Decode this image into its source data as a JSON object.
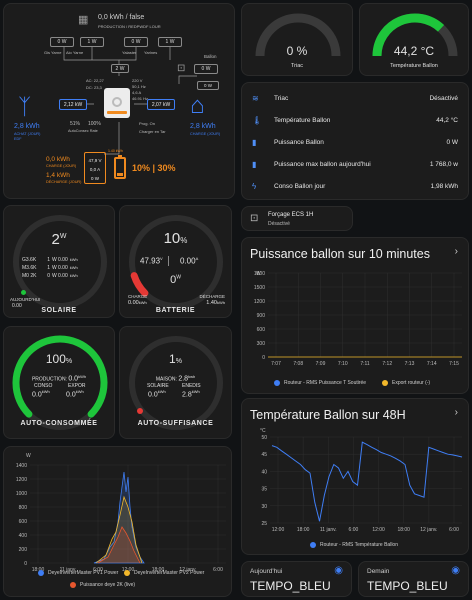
{
  "colors": {
    "blue": "#3f7ef5",
    "green": "#1ec53b",
    "orange": "#f08a1f",
    "red": "#e53935",
    "yellow": "#f2b82b",
    "grey": "#3a3a3a"
  },
  "energy": {
    "top_kwh": "0,0 kWh / false",
    "top_sub": "PRODUCTION / REDPWDF LOUR",
    "pv_boxes": [
      "0 W",
      "1 W",
      "0 W",
      "1 W"
    ],
    "pv_names": [
      "Gis Yarne",
      "Aio Yarne",
      "Yalaster",
      "Yarlnes"
    ],
    "ballon_label": "Ballon",
    "ballon_w": "0 W",
    "ballon_val2": "0 W",
    "mid_stats": [
      "AC: 22,27",
      "DC: 23,3",
      "220 V",
      "50,1 Hz",
      "4,6 A",
      "46.91 Hz"
    ],
    "inv_top_w": "2 W",
    "grid_in": "2,12 kW",
    "home_in": "2,07 kW",
    "grid_kwh": "2,8 kWh",
    "grid_label": "ACHAT (JOUR)",
    "grid_sub": "EDF",
    "home_kwh": "2,8 kWh",
    "home_label": "CHARGE (JOUR)",
    "autocons": [
      "51%",
      "100%"
    ],
    "autocons_label": "AutoConsec Rate",
    "prog_labels": [
      "Prog. On",
      "Charger en Tar"
    ],
    "charge_kwh": "0,0 kWh",
    "charge_label": "CHARGE (JOUR)",
    "decharge_kwh": "1,4 kWh",
    "decharge_label": "DÉCHARGE (JOUR)",
    "batt_box": [
      "47,9 V",
      "0,0 A",
      "0 W"
    ],
    "batt_small": "1.40 kWh",
    "batt_pct": "10% | 30%"
  },
  "gauges": {
    "triac": {
      "value": "0 %",
      "label": "Triac"
    },
    "temp": {
      "value": "44,2 °C",
      "label": "Température Ballon",
      "level": 0.74
    }
  },
  "entities": [
    {
      "icon": "≋",
      "label": "Triac",
      "value": "Désactivé"
    },
    {
      "icon": "🌡",
      "label": "Température Ballon",
      "value": "44,2 °C"
    },
    {
      "icon": "▮",
      "label": "Puissance Ballon",
      "value": "0 W"
    },
    {
      "icon": "▮",
      "label": "Puissance max ballon aujourd'hui",
      "value": "1 768,0 w"
    },
    {
      "icon": "ϟ",
      "label": "Conso Ballon jour",
      "value": "1,98 kWh"
    }
  ],
  "forcage": {
    "title": "Forçage ECS 1H",
    "state": "Désactivé"
  },
  "solaire": {
    "value": "2",
    "unit": "W",
    "rows": [
      {
        "name": "G3.6K",
        "v": "1",
        "u": "W",
        "k": "0.00",
        "ku": "kWh"
      },
      {
        "name": "M3.6K",
        "v": "1",
        "u": "W",
        "k": "0.00",
        "ku": "kWh"
      },
      {
        "name": "M0 2K",
        "v": "0",
        "u": "W",
        "k": "0.00",
        "ku": "kWh"
      }
    ],
    "aujourdhui": "AUJOURD'HUI",
    "aujourdhui_val": "0.00",
    "title": "SOLAIRE"
  },
  "batterie": {
    "pct": "10",
    "pct_unit": "%",
    "volt": "47.93",
    "volt_u": "V",
    "amp": "0.00",
    "amp_u": "A",
    "watt": "0",
    "watt_u": "W",
    "charge_label": "CHARGE",
    "charge_val": "0.00",
    "charge_u": "kWh",
    "decharge_label": "DÉCHARGE",
    "decharge_val": "1.40",
    "decharge_u": "kWh",
    "title": "BATTERIE",
    "level": 0.1
  },
  "autocons": {
    "pct": "100",
    "pct_unit": "%",
    "prod_label": "PRODUCTION:",
    "prod_val": "0.0",
    "prod_u": "kWh",
    "conso_label": "CONSO",
    "conso_val": "0.0",
    "conso_u": "kWh",
    "export_label": "EXPOR",
    "export_val": "0.0",
    "export_u": "kWh",
    "title": "AUTO-CONSOMMÉE",
    "level": 1.0
  },
  "autosuff": {
    "pct": "1",
    "pct_unit": "%",
    "maison_label": "MAISON:",
    "maison_val": "2.8",
    "maison_u": "kwh",
    "solaire_label": "SOLAIRE",
    "solaire_val": "0.0",
    "solaire_u": "kWh",
    "enedis_label": "ENEDIS",
    "enedis_val": "2.8",
    "enedis_u": "kWh",
    "title": "AUTO-SUFFISANCE",
    "level": 0.01
  },
  "pv_chart": {
    "unit": "W",
    "yticks": [
      "1400",
      "1200",
      "1000",
      "800",
      "600",
      "400",
      "200",
      "0"
    ],
    "xticks": [
      "18:00",
      "11 janv.",
      "6:00",
      "12:00",
      "18:00",
      "12 janv.",
      "6:00"
    ],
    "legend": [
      "DeyeInverterMaster PV1 Power",
      "DeyeInverterMaster PV2 Power",
      "Puissance deye 2K (live)"
    ]
  },
  "ballon10": {
    "title": "Puissance ballon sur 10 minutes",
    "unit": "W",
    "yticks": [
      "1800",
      "1500",
      "1200",
      "900",
      "600",
      "300",
      "0"
    ],
    "xticks": [
      "7:07",
      "7:08",
      "7:09",
      "7:10",
      "7:11",
      "7:12",
      "7:13",
      "7:14",
      "7:15"
    ],
    "legend": [
      "Routeur - RMS Puissance T Soutirée",
      "Export routeur (-)"
    ]
  },
  "temp48": {
    "title": "Température Ballon sur 48H",
    "unit": "°C",
    "yticks": [
      "50",
      "45",
      "40",
      "35",
      "30",
      "25"
    ],
    "xticks": [
      "12:00",
      "18:00",
      "11 janv.",
      "6:00",
      "12:00",
      "18:00",
      "12 janv.",
      "6:00"
    ],
    "legend": [
      "Routeur - RMS Température Ballon"
    ],
    "series": [
      47.5,
      47,
      46,
      45,
      44,
      43,
      42,
      40.5,
      39.5,
      31,
      25.5,
      33,
      38.5,
      42,
      41,
      38,
      40,
      37,
      36,
      48.5,
      47.8,
      47,
      46.3,
      45.5,
      45,
      44.5,
      43.8,
      43,
      42,
      36,
      33.5,
      33,
      32.5,
      47,
      46.5,
      46,
      45.5,
      45,
      44.8,
      44.5,
      44.2
    ]
  },
  "tempo": [
    {
      "label": "Aujourd'hui",
      "value": "TEMPO_BLEU"
    },
    {
      "label": "Demain",
      "value": "TEMPO_BLEU"
    }
  ]
}
